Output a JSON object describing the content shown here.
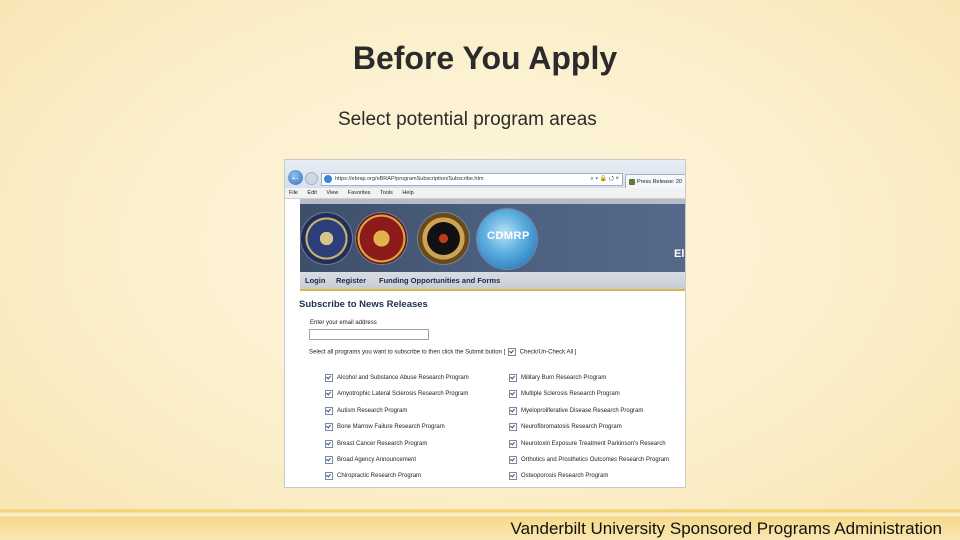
{
  "slide": {
    "title": "Before You Apply",
    "subtitle": "Select potential program areas",
    "footer": "Vanderbilt University Sponsored Programs Administration"
  },
  "browser": {
    "url": "https://ebrap.org/eBRAP/programSubscription/Subscribe.htm",
    "url_controls": "⌕ ▾ 🔒 ⭯ ×",
    "tab_label": "Press Release: 20",
    "menu": [
      "File",
      "Edit",
      "View",
      "Favorites",
      "Tools",
      "Help"
    ],
    "back_icon": "←"
  },
  "site": {
    "banner_logo_text": "CDMRP",
    "banner_edge_letter": "El",
    "nav": [
      "Login",
      "Register",
      "Funding Opportunities and Forms"
    ],
    "section_title": "Subscribe to News Releases",
    "email_label": "Enter your email address",
    "email_value": "",
    "select_all_prefix": "Select all programs you want to subscribe to then click the Submit button [",
    "select_all_label": "Check/Un-Check All ]",
    "programs_left": [
      "Alcohol and Substance Abuse Research Program",
      "Amyotrophic Lateral Sclerosis Research Program",
      "Autism Research Program",
      "Bone Marrow Failure Research Program",
      "Breast Cancer Research Program",
      "Broad Agency Announcement",
      "Chiropractic Research Program"
    ],
    "programs_right": [
      "Military Burn Research Program",
      "Multiple Sclerosis Research Program",
      "Myeloproliferative Disease Research Program",
      "Neurofibromatosis Research Program",
      "Neurotoxin Exposure Treatment Parkinson's Research",
      "Orthotics and Prosthetics Outcomes Research Program",
      "Osteoporosis Research Program"
    ]
  }
}
